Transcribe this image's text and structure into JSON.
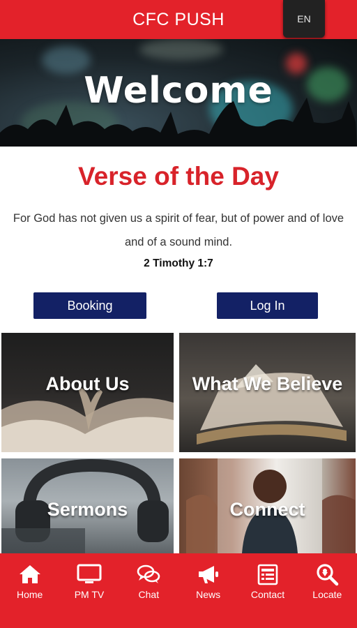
{
  "appbar": {
    "title": "CFC PUSH",
    "language": "EN"
  },
  "hero": {
    "title": "Welcome"
  },
  "verse": {
    "heading": "Verse of the Day",
    "text": "For God has not given us a spirit of fear, but of power and of love and of a sound mind.",
    "reference": "2 Timothy 1:7"
  },
  "actions": {
    "booking": "Booking",
    "login": "Log In"
  },
  "tiles": [
    {
      "label": "About Us"
    },
    {
      "label": "What We Believe"
    },
    {
      "label": "Sermons"
    },
    {
      "label": "Connect"
    }
  ],
  "nav": [
    {
      "label": "Home",
      "icon": "home-icon"
    },
    {
      "label": "PM TV",
      "icon": "tv-icon"
    },
    {
      "label": "Chat",
      "icon": "chat-icon"
    },
    {
      "label": "News",
      "icon": "megaphone-icon"
    },
    {
      "label": "Contact",
      "icon": "contact-icon"
    },
    {
      "label": "Locate",
      "icon": "search-location-icon"
    }
  ],
  "colors": {
    "brand_red": "#e3222a",
    "navy": "#132165",
    "verse_red": "#d8232a"
  }
}
